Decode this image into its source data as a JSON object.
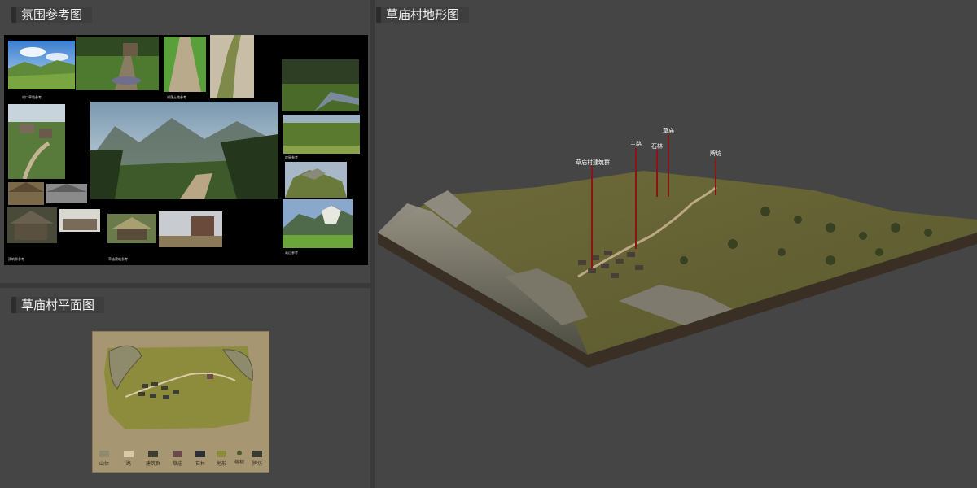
{
  "panels": {
    "mood": {
      "title": "氛围参考图"
    },
    "plan": {
      "title": "草庙村平面图"
    },
    "terrain": {
      "title": "草庙村地形图"
    }
  },
  "mood_captions": [
    "村口草地参考",
    "村落土路参考",
    "房屋参考",
    "建筑群参考",
    "石林参考",
    "高山参考",
    "草庙建筑参考",
    "村落地形参考"
  ],
  "terrain_labels": [
    "草庙村建筑群",
    "主路",
    "石林",
    "草庙",
    "牌坊"
  ],
  "legend": [
    {
      "label": "山体",
      "color": "#8e8a6c"
    },
    {
      "label": "路",
      "color": "#dcc9a8"
    },
    {
      "label": "建筑群",
      "color": "#3d3e30"
    },
    {
      "label": "草庙",
      "color": "#6b4a4a"
    },
    {
      "label": "石林",
      "color": "#2e2e36"
    },
    {
      "label": "地形",
      "color": "#8c8c3c"
    },
    {
      "label": "榕树",
      "color": "#4e5a26"
    },
    {
      "label": "牌坊",
      "color": "#3a3a34"
    }
  ]
}
